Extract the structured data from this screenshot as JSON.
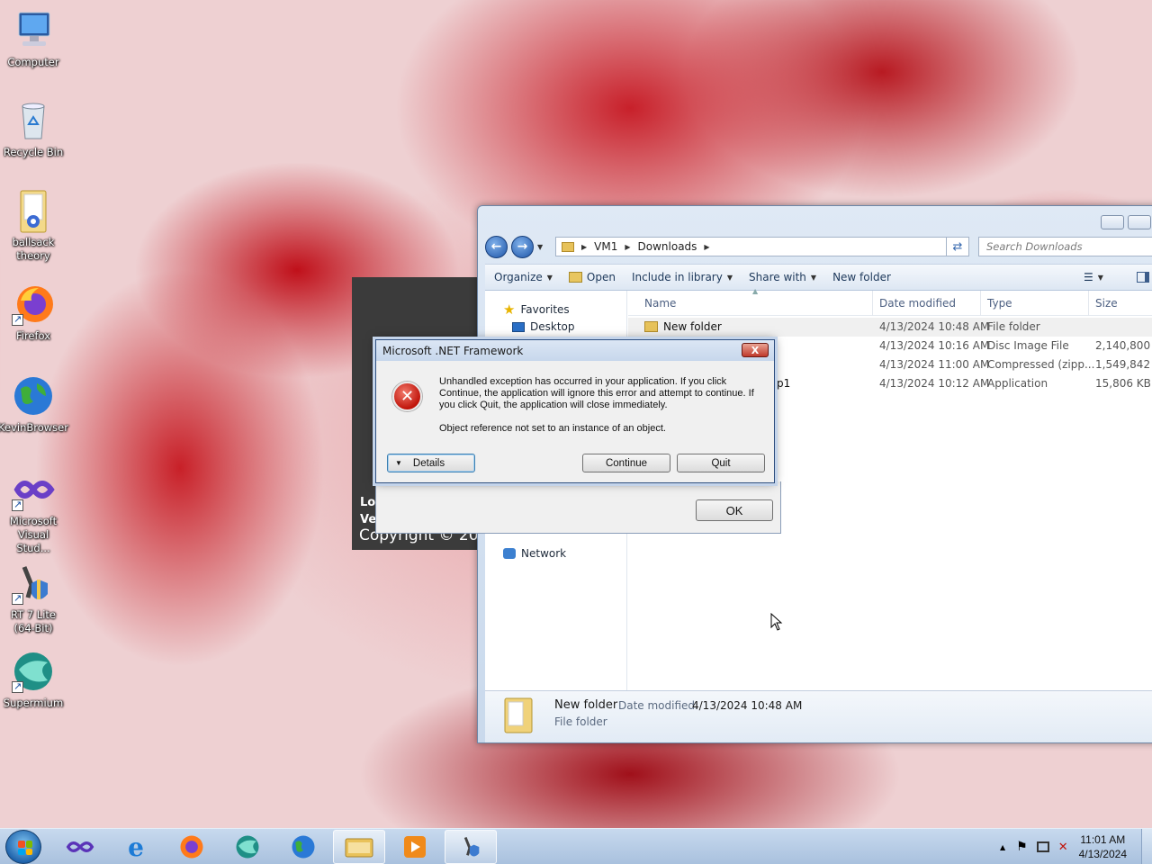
{
  "desktop": {
    "icons": [
      {
        "label": "Computer"
      },
      {
        "label": "Recycle Bin"
      },
      {
        "label": "ballsack theory"
      },
      {
        "label": "Firefox"
      },
      {
        "label": "KevinBrowser"
      },
      {
        "label": "Microsoft Visual Stud..."
      },
      {
        "label": "RT 7 Lite (64-Bit)"
      },
      {
        "label": "Supermium"
      }
    ]
  },
  "explorer": {
    "breadcrumb": [
      "VM1",
      "Downloads"
    ],
    "search_placeholder": "Search Downloads",
    "toolbar": {
      "organize": "Organize",
      "open": "Open",
      "include_in_library": "Include in library",
      "share_with": "Share with",
      "new_folder": "New folder"
    },
    "nav": {
      "favorites": "Favorites",
      "desktop": "Desktop",
      "network": "Network"
    },
    "columns": {
      "name": "Name",
      "date_modified": "Date modified",
      "type": "Type",
      "size": "Size"
    },
    "rows": [
      {
        "name": "New folder",
        "date": "4/13/2024 10:48 AM",
        "type": "File folder",
        "size": ""
      },
      {
        "name": "",
        "date": "4/13/2024 10:16 AM",
        "type": "Disc Image File",
        "size": "2,140,800 KB"
      },
      {
        "name": "",
        "date": "4/13/2024 11:00 AM",
        "type": "Compressed (zipp...",
        "size": "1,549,842 KB"
      },
      {
        "name": "p1",
        "date": "4/13/2024 10:12 AM",
        "type": "Application",
        "size": "15,806 KB"
      }
    ],
    "details": {
      "name": "New folder",
      "date_label": "Date modified:",
      "date_value": "4/13/2024 10:48 AM",
      "type": "File folder"
    }
  },
  "splash": {
    "line1": "Lo",
    "line2": "Ve",
    "copyright": "Copyright © 20"
  },
  "dialog": {
    "title": "Microsoft .NET Framework",
    "message": "Unhandled exception has occurred in your application. If you click Continue, the application will ignore this error and attempt to continue. If you click Quit, the application will close immediately.",
    "error_detail": "Object reference not set to an instance of an object.",
    "details_button": "Details",
    "continue_button": "Continue",
    "quit_button": "Quit",
    "close_glyph": "X"
  },
  "ok_dialog": {
    "ok_button": "OK"
  },
  "taskbar": {
    "time": "11:01 AM",
    "date": "4/13/2024"
  },
  "colors": {
    "accent": "#1d55a8",
    "error": "#c0140a",
    "taskbar": "#b6cbe4"
  }
}
